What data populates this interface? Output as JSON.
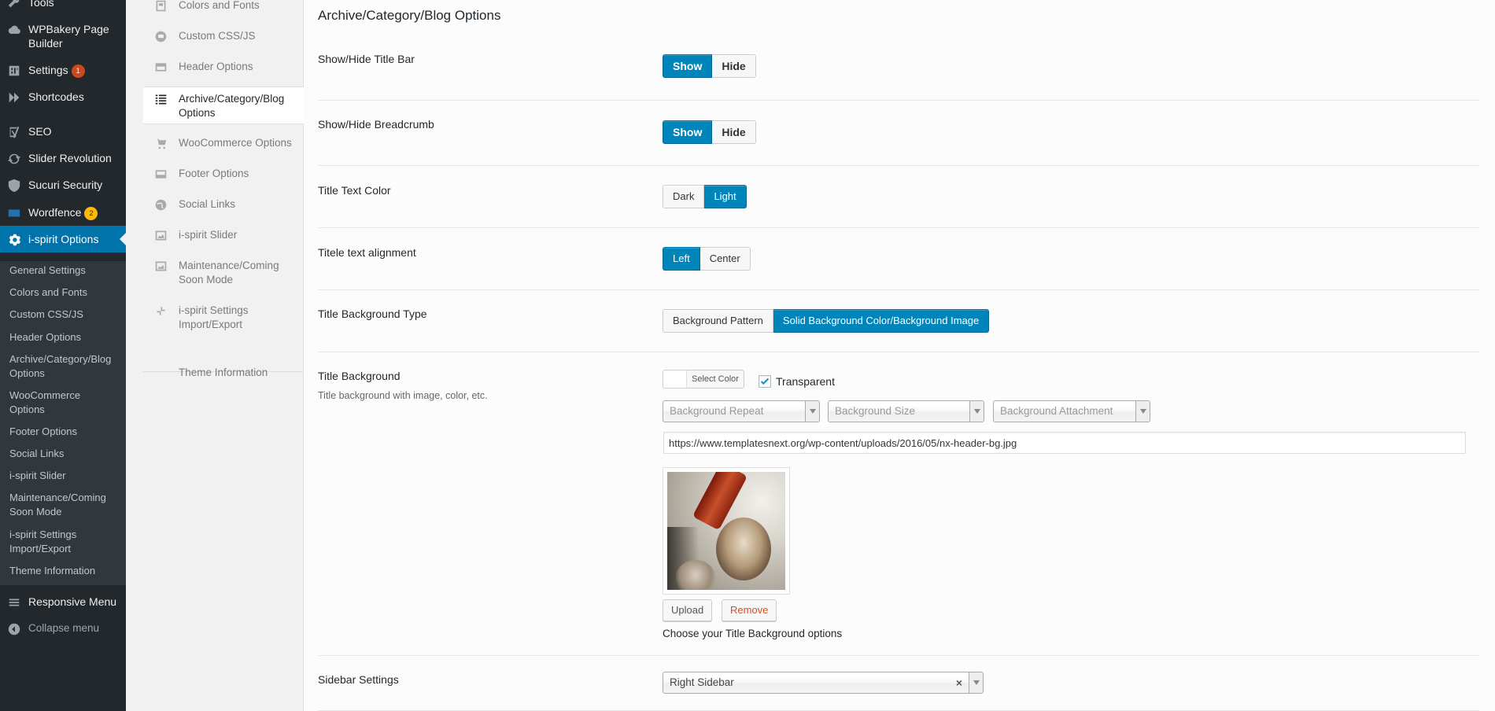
{
  "admin_menu": {
    "items": [
      {
        "label": "Tools",
        "icon": "wrench-icon"
      },
      {
        "label": "WPBakery Page Builder",
        "icon": "cloud-icon"
      },
      {
        "label": "Settings",
        "icon": "settings-icon",
        "badge": "1"
      },
      {
        "label": "Shortcodes",
        "icon": "chevron-double-icon"
      },
      {
        "label": "SEO",
        "icon": "yoast-icon"
      },
      {
        "label": "Slider Revolution",
        "icon": "refresh-icon"
      },
      {
        "label": "Sucuri Security",
        "icon": "shield-icon"
      },
      {
        "label": "Wordfence",
        "icon": "wordfence-icon",
        "badge": "2"
      },
      {
        "label": "i-spirit Options",
        "icon": "gear-icon"
      },
      {
        "label": "Responsive Menu",
        "icon": "menu-icon"
      },
      {
        "label": "Collapse menu",
        "icon": "collapse-icon"
      }
    ],
    "submenu": [
      "General Settings",
      "Colors and Fonts",
      "Custom CSS/JS",
      "Header Options",
      "Archive/Category/Blog Options",
      "WooCommerce Options",
      "Footer Options",
      "Social Links",
      "i-spirit Slider",
      "Maintenance/Coming Soon Mode",
      "i-spirit Settings Import/Export",
      "Theme Information"
    ]
  },
  "option_tabs": [
    {
      "label": "Colors and Fonts",
      "icon": "palette-icon"
    },
    {
      "label": "Custom CSS/JS",
      "icon": "code-icon"
    },
    {
      "label": "Header Options",
      "icon": "header-icon"
    },
    {
      "label": "Archive/Category/Blog Options",
      "icon": "list-icon"
    },
    {
      "label": "WooCommerce Options",
      "icon": "cart-icon"
    },
    {
      "label": "Footer Options",
      "icon": "footer-icon"
    },
    {
      "label": "Social Links",
      "icon": "globe-icon"
    },
    {
      "label": "i-spirit Slider",
      "icon": "image-icon"
    },
    {
      "label": "Maintenance/Coming Soon Mode",
      "icon": "image-icon"
    },
    {
      "label": "i-spirit Settings Import/Export",
      "icon": "import-export-icon"
    },
    {
      "label": "Theme Information",
      "icon": ""
    }
  ],
  "main": {
    "section_title": "Archive/Category/Blog Options",
    "title_bar": {
      "label": "Show/Hide Title Bar",
      "options": [
        "Show",
        "Hide"
      ],
      "selected": "Show"
    },
    "breadcrumb": {
      "label": "Show/Hide Breadcrumb",
      "options": [
        "Show",
        "Hide"
      ],
      "selected": "Show"
    },
    "title_text_color": {
      "label": "Title Text Color",
      "options": [
        "Dark",
        "Light"
      ],
      "selected": "Light"
    },
    "title_alignment": {
      "label": "Titele text alignment",
      "options": [
        "Left",
        "Center"
      ],
      "selected": "Left"
    },
    "title_bg_type": {
      "label": "Title Background Type",
      "options": [
        "Background Pattern",
        "Solid Background Color/Background Image"
      ],
      "selected": "Solid Background Color/Background Image"
    },
    "title_background": {
      "label": "Title Background",
      "description": "Title background with image, color, etc.",
      "select_color_label": "Select Color",
      "transparent_label": "Transparent",
      "transparent_checked": true,
      "repeat_placeholder": "Background Repeat",
      "size_placeholder": "Background Size",
      "attachment_placeholder": "Background Attachment",
      "image_url": "https://www.templatesnext.org/wp-content/uploads/2016/05/nx-header-bg.jpg",
      "upload_label": "Upload",
      "remove_label": "Remove",
      "help_text": "Choose your Title Background options"
    },
    "sidebar": {
      "label": "Sidebar Settings",
      "value": "Right Sidebar",
      "clear_glyph": "×"
    }
  },
  "colors": {
    "accent": "#0085ba",
    "admin_bg": "#23282d",
    "badge_red": "#ca4a1f",
    "badge_yellow": "#ffb900"
  }
}
